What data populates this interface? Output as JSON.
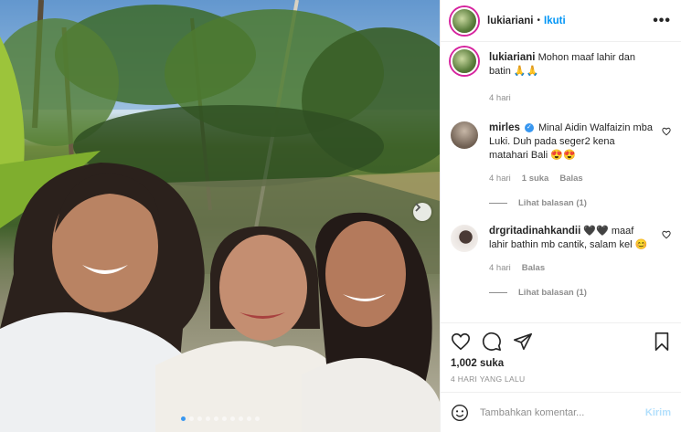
{
  "post": {
    "username": "lukiariani",
    "follow_label": "Ikuti",
    "bullet": "•",
    "more_label": "•••"
  },
  "caption": {
    "username": "lukiariani",
    "text": "Mohon maaf lahir dan batin 🙏🙏",
    "time": "4 hari"
  },
  "comments": [
    {
      "username": "mirles",
      "verified": true,
      "text": "Minal Aidin Walfaizin mba Luki. Duh pada seger2 kena matahari Bali 😍😍",
      "time": "4 hari",
      "likes": "1 suka",
      "reply_label": "Balas",
      "view_replies": "Lihat balasan (1)"
    },
    {
      "username": "drgritadinahkandii",
      "verified": false,
      "text": "🖤🖤 maaf lahir bathin mb cantik, salam kel 😊",
      "time": "4 hari",
      "reply_label": "Balas",
      "view_replies": "Lihat balasan (1)"
    }
  ],
  "stats": {
    "likes": "1,002 suka",
    "time_ago": "4 HARI YANG LALU"
  },
  "composer": {
    "placeholder": "Tambahkan komentar...",
    "post_label": "Kirim"
  },
  "carousel": {
    "total": 10,
    "active": 0
  },
  "colors": {
    "accent": "#0095f6",
    "muted": "#8e8e8e",
    "post_disabled": "#b2dffc"
  },
  "icons": [
    "heart-icon",
    "comment-icon",
    "share-icon",
    "bookmark-icon",
    "emoji-icon",
    "chevron-right-icon",
    "more-icon",
    "verified-icon"
  ]
}
